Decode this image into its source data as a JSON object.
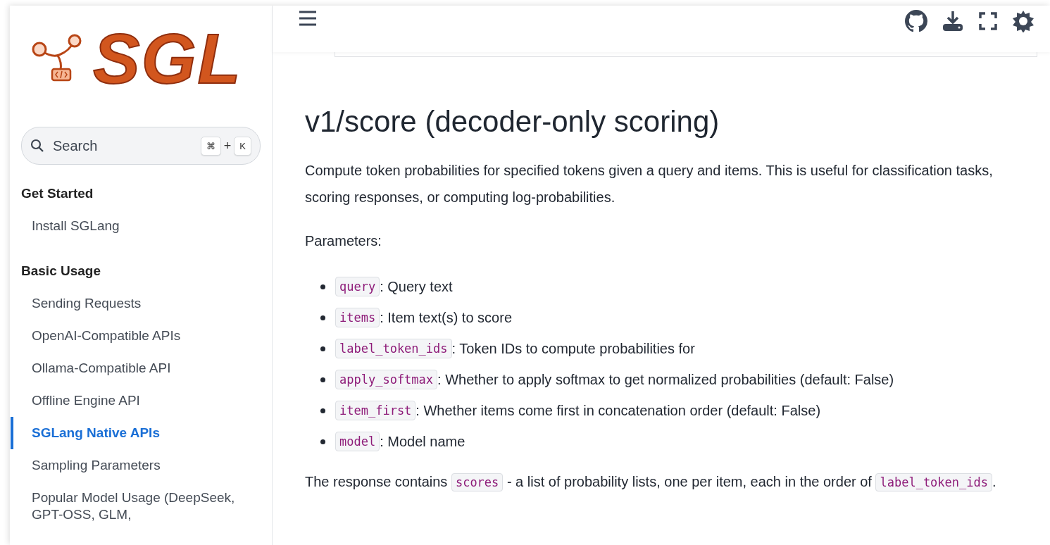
{
  "logo": {
    "text": "SGL"
  },
  "search": {
    "placeholder": "Search",
    "keys": [
      "⌘",
      "+",
      "K"
    ]
  },
  "sidebar": {
    "sections": [
      {
        "title": "Get Started",
        "items": [
          {
            "label": "Install SGLang",
            "selected": false
          }
        ]
      },
      {
        "title": "Basic Usage",
        "items": [
          {
            "label": "Sending Requests",
            "selected": false
          },
          {
            "label": "OpenAI-Compatible APIs",
            "selected": false
          },
          {
            "label": "Ollama-Compatible API",
            "selected": false
          },
          {
            "label": "Offline Engine API",
            "selected": false
          },
          {
            "label": "SGLang Native APIs",
            "selected": true
          },
          {
            "label": "Sampling Parameters",
            "selected": false
          },
          {
            "label": "Popular Model Usage (DeepSeek, GPT-OSS, GLM,",
            "selected": false
          }
        ]
      }
    ]
  },
  "content": {
    "title": "v1/score (decoder-only scoring)",
    "intro": "Compute token probabilities for specified tokens given a query and items. This is useful for classification tasks, scoring responses, or computing log-probabilities.",
    "params_label": "Parameters:",
    "params": [
      {
        "code": "query",
        "text": ": Query text"
      },
      {
        "code": "items",
        "text": ": Item text(s) to score"
      },
      {
        "code": "label_token_ids",
        "text": ": Token IDs to compute probabilities for"
      },
      {
        "code": "apply_softmax",
        "text": ": Whether to apply softmax to get normalized probabilities (default: False)"
      },
      {
        "code": "item_first",
        "text": ": Whether items come first in concatenation order (default: False)"
      },
      {
        "code": "model",
        "text": ": Model name"
      }
    ],
    "response": [
      {
        "kind": "text",
        "text": "The response contains "
      },
      {
        "kind": "code",
        "text": "scores"
      },
      {
        "kind": "text",
        "text": " - a list of probability lists, one per item, each in the order of "
      },
      {
        "kind": "code",
        "text": "label_token_ids"
      },
      {
        "kind": "text",
        "text": "."
      }
    ]
  }
}
